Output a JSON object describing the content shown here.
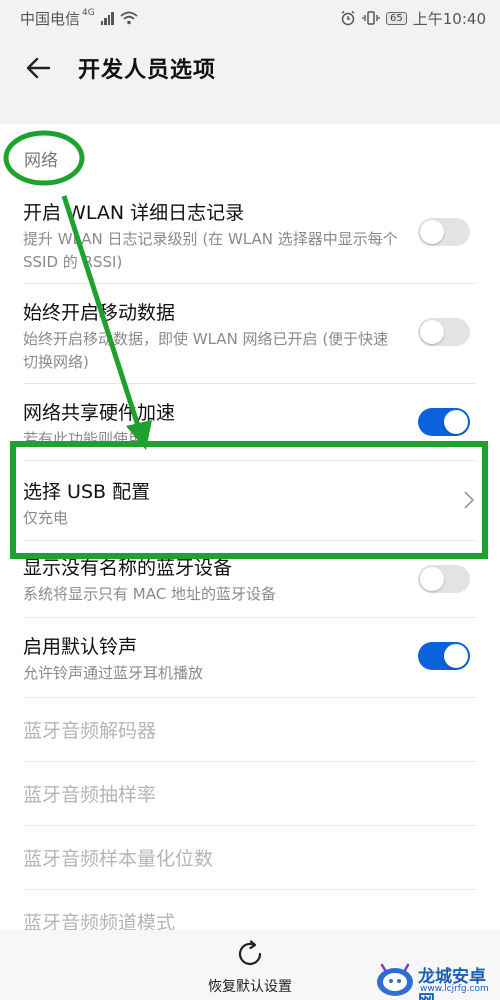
{
  "status_bar": {
    "carrier": "中国电信",
    "network": "4G",
    "battery": "65",
    "time": "上午10:40"
  },
  "header": {
    "title": "开发人员选项",
    "back_icon": "arrow-left-icon"
  },
  "section": {
    "title": "网络"
  },
  "settings": [
    {
      "title": "开启 WLAN 详细日志记录",
      "subtitle": "提升 WLAN 日志记录级别 (在 WLAN 选择器中显示每个 SSID 的 RSSI)",
      "toggle": false
    },
    {
      "title": "始终开启移动数据",
      "subtitle": "始终开启移动数据，即使 WLAN 网络已开启 (便于快速切换网络)",
      "toggle": false
    },
    {
      "title": "网络共享硬件加速",
      "subtitle": "若有此功能则使用",
      "toggle": true
    },
    {
      "title": "选择 USB 配置",
      "subtitle": "仅充电",
      "chevron": true
    },
    {
      "title": "显示没有名称的蓝牙设备",
      "subtitle": "系统将显示只有 MAC 地址的蓝牙设备",
      "toggle": false
    },
    {
      "title": "启用默认铃声",
      "subtitle": "允许铃声通过蓝牙耳机播放",
      "toggle": true
    },
    {
      "title": "蓝牙音频解码器",
      "disabled": true
    },
    {
      "title": "蓝牙音频抽样率",
      "disabled": true
    },
    {
      "title": "蓝牙音频样本量化位数",
      "disabled": true
    },
    {
      "title": "蓝牙音频频道模式",
      "disabled": true
    }
  ],
  "bottom_bar": {
    "reset_label": "恢复默认设置"
  },
  "watermark": {
    "text": "龙城安卓网",
    "url": "www.lcjrfg.com"
  },
  "colors": {
    "accent": "#0a63dc",
    "annotation": "#1fa12e",
    "background": "#f2f2f2",
    "card": "#ffffff"
  }
}
